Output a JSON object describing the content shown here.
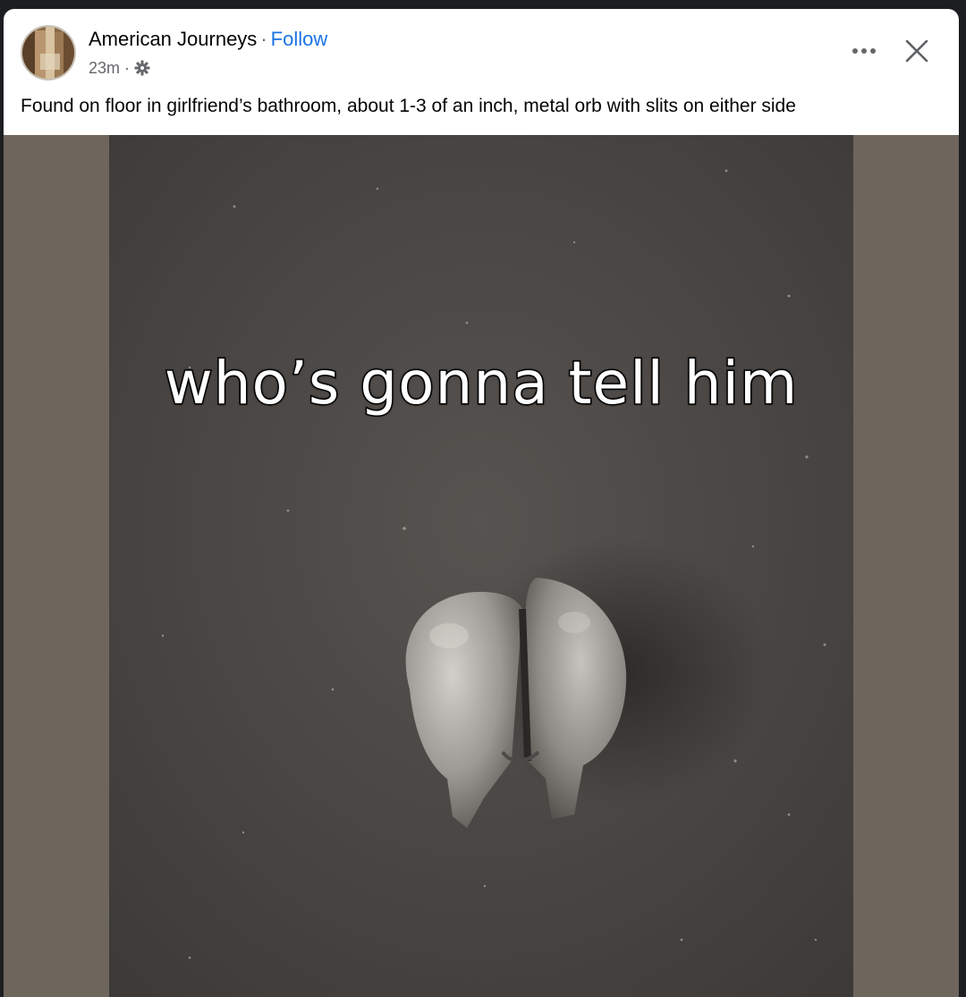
{
  "post": {
    "author": "American Journeys",
    "separator": "·",
    "follow_label": "Follow",
    "timestamp": "23m",
    "meta_separator": "·",
    "caption": "Found on floor in girlfriend’s bathroom, about 1-3 of an inch, metal orb with slits on either side",
    "more_icon": "more-horizontal-icon",
    "close_icon": "close-icon",
    "audience_icon": "gear-icon"
  },
  "media": {
    "overlay_text": "who’s gonna tell him",
    "background_color": "#6e655d"
  },
  "colors": {
    "link": "#1b74e4",
    "text_primary": "#050505",
    "text_secondary": "#65676b"
  }
}
